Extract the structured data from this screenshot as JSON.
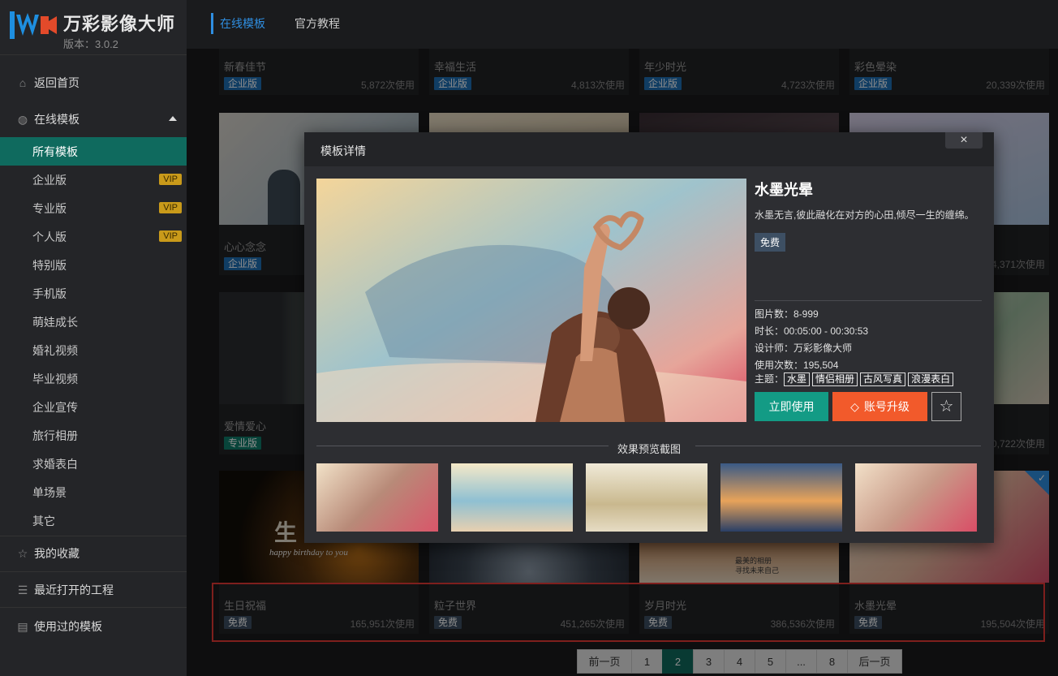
{
  "app": {
    "name": "万彩影像大师",
    "version": "版本：3.0.2"
  },
  "colors": {
    "accent": "#0f6a5e",
    "vip": "#c99a1a",
    "enterprise_badge": "#1e6fb5",
    "pro_badge": "#0f7c6a",
    "free_badge": "#3d4f63",
    "use_button": "#139b85",
    "upgrade_button": "#f25a2b",
    "highlight_box": "#e53935"
  },
  "sidebar": {
    "home": "返回首页",
    "online": "在线模板",
    "subitems": [
      {
        "label": "所有模板",
        "vip": ""
      },
      {
        "label": "企业版",
        "vip": "VIP"
      },
      {
        "label": "专业版",
        "vip": "VIP"
      },
      {
        "label": "个人版",
        "vip": "VIP"
      },
      {
        "label": "特别版",
        "vip": ""
      },
      {
        "label": "手机版",
        "vip": ""
      },
      {
        "label": "萌娃成长",
        "vip": ""
      },
      {
        "label": "婚礼视频",
        "vip": ""
      },
      {
        "label": "毕业视频",
        "vip": ""
      },
      {
        "label": "企业宣传",
        "vip": ""
      },
      {
        "label": "旅行相册",
        "vip": ""
      },
      {
        "label": "求婚表白",
        "vip": ""
      },
      {
        "label": "单场景",
        "vip": ""
      },
      {
        "label": "其它",
        "vip": ""
      }
    ],
    "favorites": "我的收藏",
    "recent": "最近打开的工程",
    "used": "使用过的模板"
  },
  "tabs": [
    "在线模板",
    "官方教程"
  ],
  "grid": {
    "row1": [
      {
        "title": "新春佳节",
        "badge": "企业版",
        "uses": "5,872次使用"
      },
      {
        "title": "幸福生活",
        "badge": "企业版",
        "uses": "4,813次使用"
      },
      {
        "title": "年少时光",
        "badge": "企业版",
        "uses": "4,723次使用"
      },
      {
        "title": "彩色晕染",
        "badge": "企业版",
        "uses": "20,339次使用"
      }
    ],
    "row2_left": {
      "title": "心心念念",
      "badge": "企业版"
    },
    "row2_right_uses": "4,371次使用",
    "row3_left": {
      "title": "爱情爱心",
      "badge": "专业版"
    },
    "row3_right_uses": "0,722次使用",
    "row4": [
      {
        "title": "生日祝福",
        "badge": "免费",
        "uses": "165,951次使用",
        "thumb_text": "生 日",
        "thumb_sub": "happy birthday to you"
      },
      {
        "title": "粒子世界",
        "badge": "免费",
        "uses": "451,265次使用"
      },
      {
        "title": "岁月时光",
        "badge": "免费",
        "uses": "386,536次使用",
        "thumb_text": "最美的相册\n寻找未来自己"
      },
      {
        "title": "水墨光晕",
        "badge": "免费",
        "uses": "195,504次使用"
      }
    ]
  },
  "pagination": [
    "前一页",
    "1",
    "2",
    "3",
    "4",
    "5",
    "...",
    "8",
    "后一页"
  ],
  "pagination_active": "2",
  "modal": {
    "header": "模板详情",
    "close": "×",
    "name": "水墨光晕",
    "desc": "水墨无言,彼此融化在对方的心田,倾尽一生的缠绵。",
    "price": "免费",
    "pic_count": "图片数：8-999",
    "duration": "时长：00:05:00 - 00:30:53",
    "designer": "设计师：万彩影像大师",
    "use_count": "使用次数：195,504",
    "theme_label": "主题：",
    "themes": [
      "水墨",
      "情侣相册",
      "古风写真",
      "浪漫表白"
    ],
    "use_button": "立即使用",
    "upgrade_button": "账号升级",
    "section_title": "效果预览截图"
  }
}
